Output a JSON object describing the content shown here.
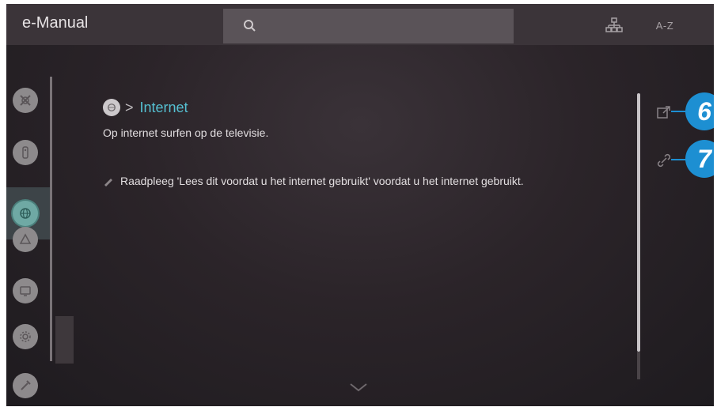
{
  "header": {
    "title": "e-Manual",
    "search_placeholder": "",
    "az_label": "A-Z"
  },
  "sidebar": {
    "items": [
      {
        "icon": "quick-guide-icon"
      },
      {
        "icon": "remote-icon"
      },
      {
        "icon": "connections-icon",
        "selected": true
      },
      {
        "icon": "smart-features-icon"
      },
      {
        "icon": "tv-viewing-icon"
      },
      {
        "icon": "settings-icon"
      },
      {
        "icon": "troubleshooting-icon"
      }
    ]
  },
  "content": {
    "breadcrumb_label": "Internet",
    "description": "Op internet surfen op de televisie.",
    "note": "Raadpleeg 'Lees dit voordat u het internet gebruikt' voordat u het internet gebruikt."
  },
  "callouts": {
    "first": "6",
    "second": "7"
  },
  "colors": {
    "accent_text": "#55c0d2",
    "callout": "#1d8fd2",
    "selected_nav": "#6fa9a4"
  }
}
